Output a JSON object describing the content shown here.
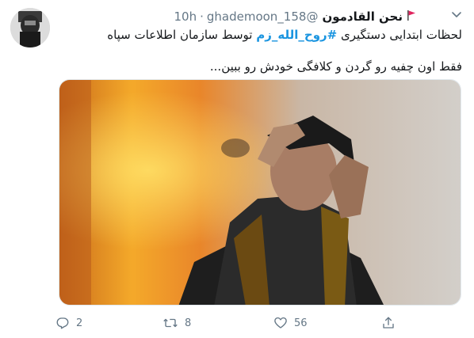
{
  "tweet": {
    "author": {
      "display_name": "نحن القادمون",
      "handle": "@ghademoon_158",
      "separator": "·",
      "time": "10h"
    },
    "text": {
      "line1_prefix": "لحظات ابتدایی دستگیری",
      "hashtag": "#روح_الله_زم",
      "line1_suffix": "توسط سازمان اطلاعات سپاه",
      "line3": "فقط اون چفیه رو گردن و کلافگی خودش رو ببین..."
    },
    "media": {
      "type": "image"
    },
    "actions": {
      "reply_count": "2",
      "retweet_count": "8",
      "like_count": "56"
    }
  },
  "icons": [
    "flag-icon",
    "caret-down-icon",
    "reply-icon",
    "retweet-icon",
    "like-icon",
    "share-icon"
  ],
  "colors": {
    "hashtag": "#1b95e0",
    "muted": "#657786",
    "flag": "#e0245e"
  }
}
